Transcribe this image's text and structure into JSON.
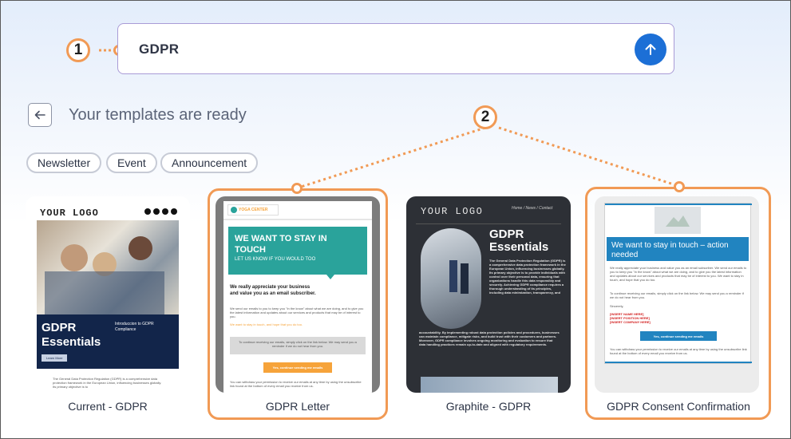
{
  "search": {
    "value": "GDPR"
  },
  "heading": "Your templates are ready",
  "callouts": [
    "1",
    "2"
  ],
  "chips": [
    "Newsletter",
    "Event",
    "Announcement"
  ],
  "cards": [
    {
      "label": "Current - GDPR",
      "logo": "YOUR LOGO",
      "title": "GDPR\nEssentials",
      "side_text": "Introduccion to GDPR Compliance",
      "button": "Learn More",
      "body": "The General Data Protection Regulation (GDPR) is a comprehensive data protection framework in the European Union, influencing businesses globally. Its primary objective is to"
    },
    {
      "label": "GDPR Letter",
      "brand": "YOGA CENTER",
      "banner_title": "WE WANT TO STAY IN TOUCH",
      "banner_sub": "LET US KNOW IF YOU WOULD TOO",
      "intro": "We really appreciate your business and value you as an email subscriber.",
      "body": "We send our emails to you to keep you \"in the know\" about what we are doing, and to give you the latest information and updates about our services and products that may be of interest to you.",
      "orange_line": "We want to stay in touch, and hope that you do too.",
      "gray_box": "To continue receiving our emails, simply click on the link below. We may send you a reminder if we do not hear from you.",
      "button": "Yes, continue sending me emails",
      "footer": "You can withdraw your permission to receive our emails at any time by using the unsubscribe link found at the bottom of every email you receive from us."
    },
    {
      "label": "Graphite - GDPR",
      "logo": "YOUR LOGO",
      "nav": "Home / News / Contact",
      "title": "GDPR Essentials",
      "intro": "The General Data Protection Regulation (GDPR) is a comprehensive data protection framework in the European Union, influencing businesses globally. Its primary objective is to provide individuals with control over their personal data, ensuring that organizations handle this data responsibly and securely. Achieving GDPR compliance requires a thorough understanding of its principles, including data minimization, transparency, and",
      "body": "accountability. By implementing robust data protection policies and procedures, businesses can maintain compliance, mitigate risks, and build trust with their customers and partners. Moreover, GDPR compliance involves ongoing monitoring and evaluation to ensure that data handling practices remain up-to-date and aligned with regulatory requirements."
    },
    {
      "label": "GDPR Consent Confirmation",
      "banner_title": "We want to stay in touch – action needed",
      "p1": "We really appreciate your business and value you as an email subscriber. We send our emails to you to keep you \"in the know\" about what we are doing, and to give you the latest information and updates about our services and products that may be of interest to you. We want to stay in touch, and hope that you do too.",
      "p2": "To continue receiving our emails, simply click on the link below. We may send you a reminder if we do not hear from you.",
      "sincerely": "Sincerely,",
      "name": "[INSERT NAME HERE]",
      "position": "[INSERT POSITION HERE]",
      "company": "[INSERT COMPANY HERE]",
      "button": "Yes, continue sending me emails",
      "footer": "You can withdraw your permission to receive our emails at any time by using the unsubscribe link found at the bottom of every email you receive from us."
    }
  ],
  "colors": {
    "accent": "#1c6fd6",
    "callout": "#f19a55",
    "teal": "#2aa39b",
    "graphite": "#2d3036",
    "blue_banner": "#2184c0",
    "yoga_orange": "#f6a33a"
  }
}
